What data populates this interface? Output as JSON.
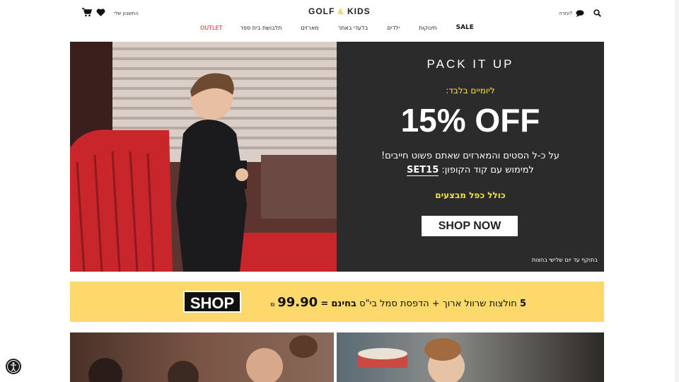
{
  "header": {
    "logo_left": "GOLF",
    "logo_amp": "&",
    "logo_right": "KIDS",
    "account_label": "החשבון שלי",
    "help_label": "עזרה?"
  },
  "nav": {
    "items": [
      {
        "label": "OUTLET"
      },
      {
        "label": "תלבושת בית ספר"
      },
      {
        "label": "מארזים"
      },
      {
        "label": "בלעדי באתר"
      },
      {
        "label": "ילדים"
      },
      {
        "label": "תינוקות"
      },
      {
        "label": "SALE"
      }
    ]
  },
  "hero": {
    "pack_title": "PACK IT UP",
    "days_only": "ליומיים בלבד:",
    "discount": "15% OFF",
    "line1": "על כ-ל הסטים והמארזים שאתם פשוט חייבים!",
    "line2_prefix": "למימוש עם קוד הקופון:",
    "coupon_code": "SET15",
    "includes": "כולל כפל מבצעים",
    "cta": "SHOP NOW",
    "validity": "בתוקף עד יום שלישי בחצות"
  },
  "banner": {
    "shop_label": "SHOP",
    "count": "5",
    "text_part1": "חולצות שרוול ארוך + הדפסת סמל בי\"ס",
    "free_word": "בחינם",
    "equals": "=",
    "price": "99.90",
    "currency": "₪"
  },
  "colors": {
    "promo_bg": "#2b2b2b",
    "yellow_text": "#f7e23a",
    "banner_bg": "#fdd96b",
    "outlet_red": "#d81e2a"
  },
  "icons": [
    "cart-icon",
    "heart-icon",
    "chat-icon",
    "search-icon",
    "accessibility-icon"
  ]
}
